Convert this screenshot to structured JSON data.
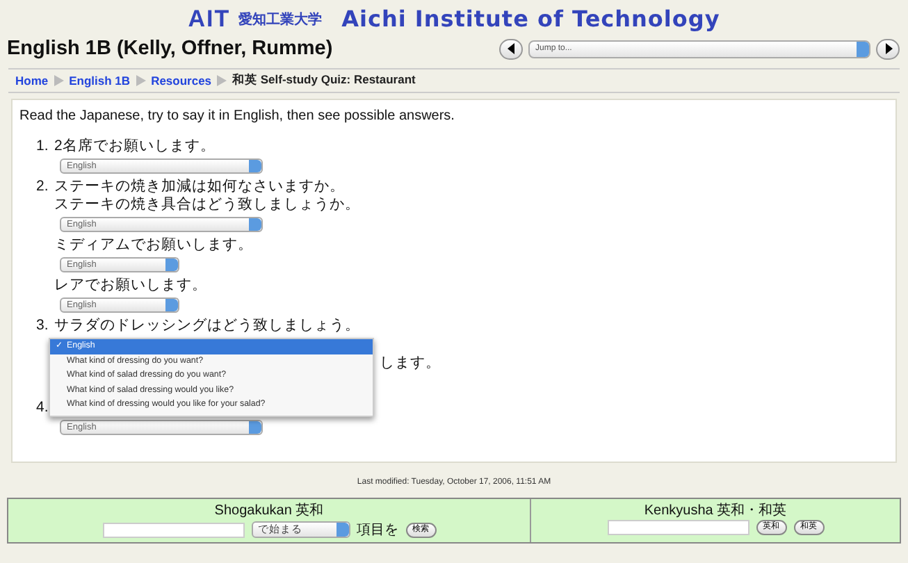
{
  "logo": {
    "mark": "AIT",
    "japanese": "愛知工業大学",
    "english": "Aichi Institute of Technology"
  },
  "course_title": "English 1B (Kelly, Offner, Rumme)",
  "jump": {
    "value": "Jump to..."
  },
  "breadcrumb": [
    {
      "label": "Home",
      "link": true
    },
    {
      "label": "English 1B",
      "link": true
    },
    {
      "label": "Resources",
      "link": true
    },
    {
      "label": "和英 Self-study Quiz: Restaurant",
      "link": false
    }
  ],
  "instructions": "Read the Japanese, try to say it in English, then see possible answers.",
  "questions": [
    {
      "number": "1.",
      "lines": [
        {
          "text": "2名席でお願いします。",
          "answer": {
            "value": "English",
            "wide": true
          }
        }
      ]
    },
    {
      "number": "2.",
      "lines": [
        {
          "text": "ステーキの焼き加減は如何なさいますか。"
        },
        {
          "text": "ステーキの焼き具合はどう致しましょうか。",
          "answer": {
            "value": "English",
            "wide": true
          }
        },
        {
          "text": "ミディアムでお願いします。",
          "answer": {
            "value": "English",
            "wide": false
          }
        },
        {
          "text": "レアでお願いします。",
          "answer": {
            "value": "English",
            "wide": false
          }
        }
      ]
    },
    {
      "number": "3.",
      "lines": [
        {
          "text": "サラダのドレッシングはどう致しましょう。",
          "open_menu": [
            {
              "label": "English",
              "check": "✓",
              "selected": true
            },
            {
              "label": "What kind of dressing do you want?",
              "selected": false
            },
            {
              "label": "What kind of salad dressing do you want?",
              "selected": false
            },
            {
              "label": "What kind of salad dressing would you like?",
              "selected": false
            },
            {
              "label": "What kind of dressing would you like for your salad?",
              "selected": false
            }
          ]
        }
      ],
      "tail_text": "します。"
    },
    {
      "number": "4.",
      "lines": [
        {
          "answer": {
            "value": "English",
            "wide": true
          }
        }
      ]
    }
  ],
  "last_modified": "Last modified: Tuesday, October 17, 2006, 11:51 AM",
  "dictionaries": [
    {
      "title": "Shogakukan 英和",
      "select": "で始まる",
      "after": "項目を",
      "buttons": [
        "検索"
      ]
    },
    {
      "title": "Kenkyusha 英和・和英",
      "buttons": [
        "英和",
        "和英"
      ]
    }
  ]
}
